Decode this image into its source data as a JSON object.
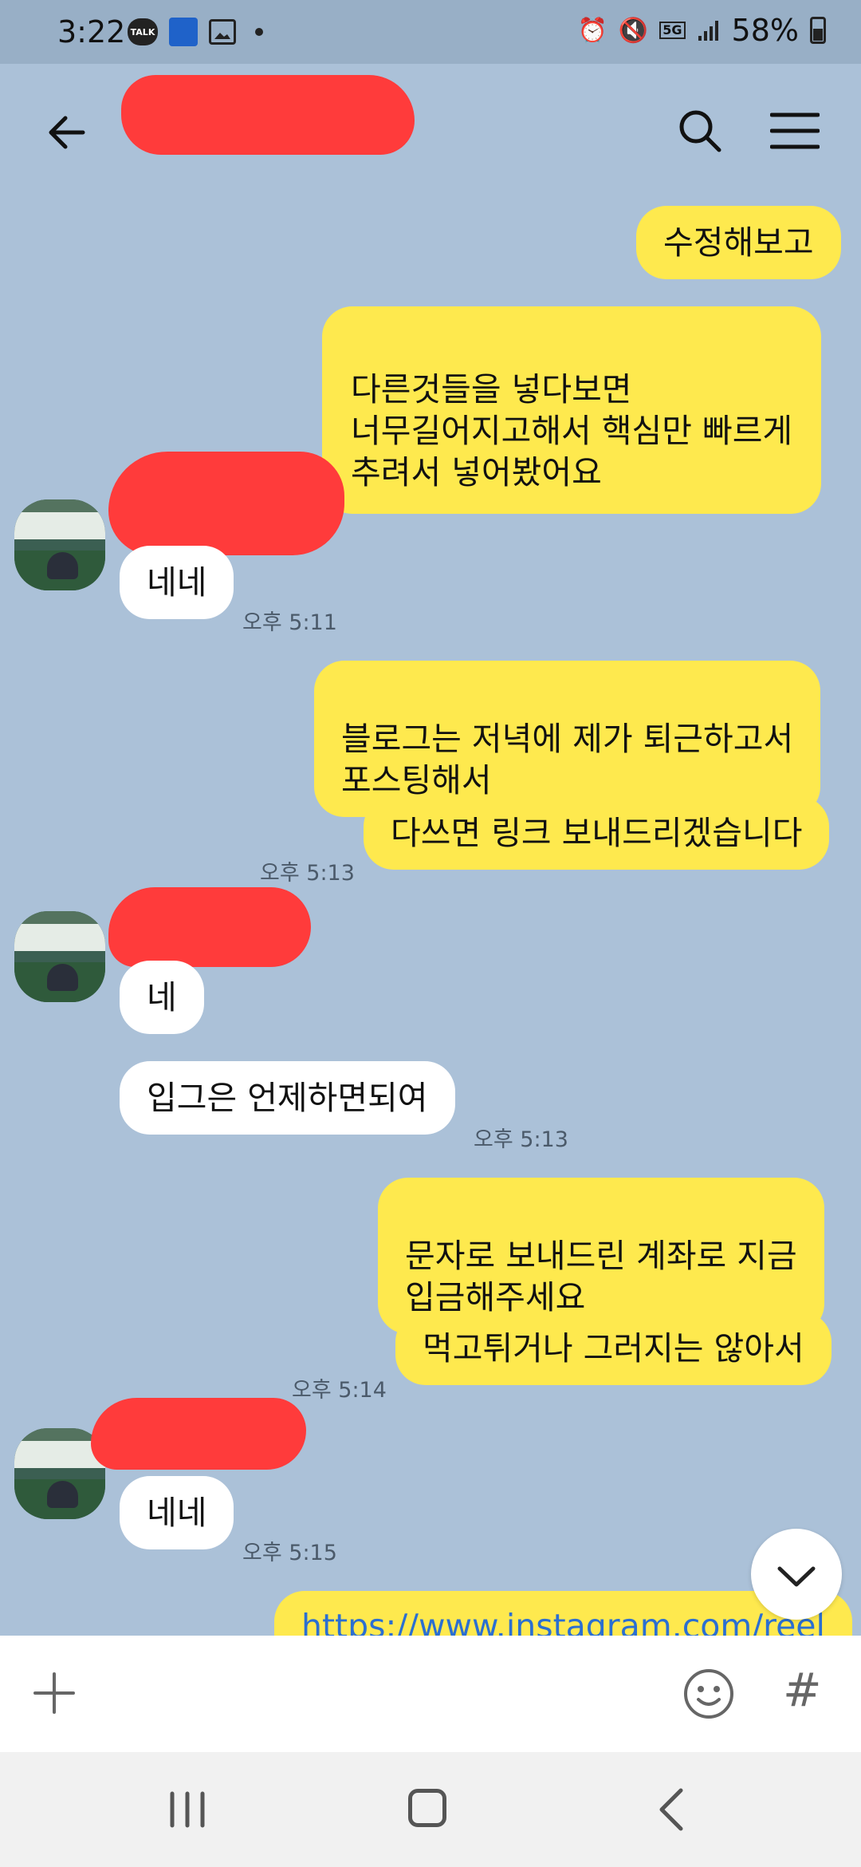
{
  "status_bar": {
    "time": "3:22",
    "talk_badge": "TALK",
    "network": "5G",
    "battery": "58%"
  },
  "header": {
    "back_icon": "arrow-left-icon",
    "search_icon": "search-icon",
    "menu_icon": "hamburger-menu-icon"
  },
  "messages": [
    {
      "from": "me",
      "text": "수정해보고"
    },
    {
      "from": "me",
      "text": "다른것들을 넣다보면\n너무길어지고해서 핵심만 빠르게\n추려서 넣어봤어요"
    },
    {
      "from": "other",
      "text": "네네",
      "time": "오후 5:11"
    },
    {
      "from": "me",
      "text": "블로그는 저녁에 제가 퇴근하고서\n포스팅해서"
    },
    {
      "from": "me",
      "text": "다쓰면 링크 보내드리겠습니다",
      "time": "오후 5:13"
    },
    {
      "from": "other",
      "text": "네"
    },
    {
      "from": "other",
      "text": "입그은 언제하면되여",
      "time": "오후 5:13"
    },
    {
      "from": "me",
      "text": "문자로 보내드린 계좌로 지금\n입금해주세요"
    },
    {
      "from": "me",
      "text": "먹고튀거나 그러지는 않아서",
      "time": "오후 5:14"
    },
    {
      "from": "other",
      "text": "네네",
      "time": "오후 5:15"
    },
    {
      "from": "me",
      "text": "https://www.instagram.com/reel"
    }
  ],
  "input_bar": {
    "plus_icon": "plus-icon",
    "emoji_icon": "emoji-icon",
    "hash_label": "#"
  },
  "colors": {
    "chat_bg": "#abc1d8",
    "my_bubble": "#fee94e",
    "other_bubble": "#ffffff",
    "redaction": "#ff3b3b",
    "link": "#2b6fd1"
  }
}
